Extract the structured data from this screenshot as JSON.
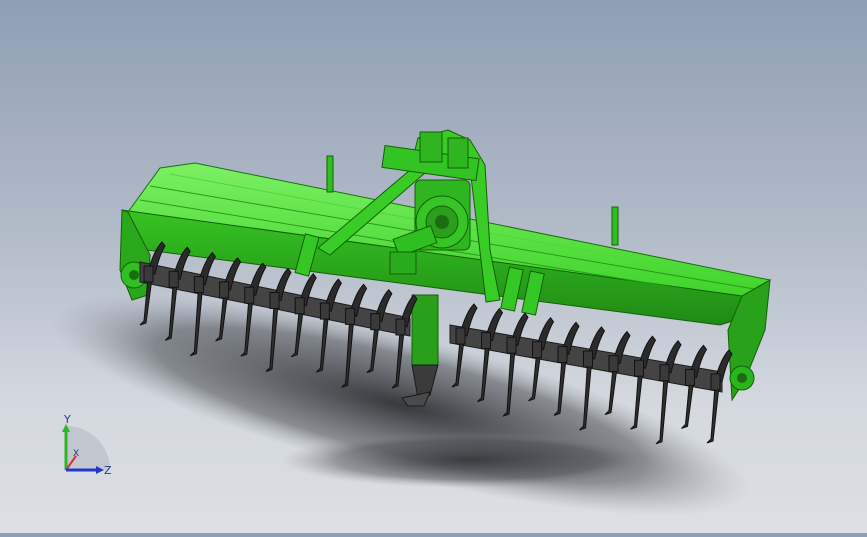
{
  "viewport": {
    "model": "rotary-tiller",
    "colors": {
      "bg_top": "#8f9fb4",
      "bg_bottom": "#dcdfe4",
      "body_green": "#3fd42a",
      "body_green_light": "#6cec52",
      "body_green_dark": "#1f8a14",
      "blade_dark": "#2b2b2b",
      "shaft_grey": "#4a4a4a",
      "shadow": "#2f3134"
    }
  },
  "triad": {
    "y_label": "Y",
    "x_label": "X",
    "z_label": "Z",
    "colors": {
      "y": "#2fb52a",
      "x": "#d8342a",
      "z": "#2438c8"
    }
  }
}
